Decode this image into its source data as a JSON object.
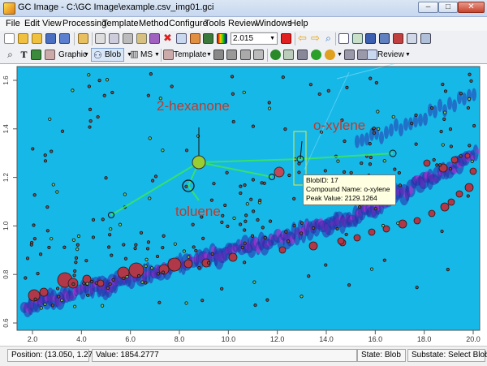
{
  "window": {
    "title": "GC Image - C:\\GC Image\\example.csv_img01.gci",
    "min_glyph": "–",
    "max_glyph": "□",
    "close_glyph": "✕"
  },
  "menu": [
    "File",
    "Edit",
    "View",
    "Processing",
    "Template",
    "Method",
    "Configure",
    "Tools",
    "Review",
    "Windows",
    "Help"
  ],
  "toolbar": {
    "zoom_value": "2.015",
    "graphic_label": "Graphic",
    "blob_label": "Blob",
    "ms_label": "MS",
    "template_label": "Template",
    "review_label": "Review"
  },
  "plot": {
    "x_ticks": [
      "2.0",
      "4.0",
      "6.0",
      "8.0",
      "10.0",
      "12.0",
      "14.0",
      "16.0",
      "18.0",
      "20.0"
    ],
    "y_ticks": [
      "1.6",
      "1.4",
      "1.2",
      "1.0",
      "0.8",
      "0.6"
    ],
    "background": "#16b8e8",
    "peak_color": "#b03848",
    "labels": {
      "hexanone": "2-hexanone",
      "xylene": "o-xylene",
      "toluene": "toluene"
    }
  },
  "tooltip": {
    "line1": "BlobID: 17",
    "line2": "Compound Name: o-xylene",
    "line3": "Peak Value: 2129.1264"
  },
  "status": {
    "position": "Position: (13.050, 1.275)",
    "value": "Value: 1854.2777",
    "state": "State: Blob",
    "substate": "Substate: Select Blob(s)"
  }
}
